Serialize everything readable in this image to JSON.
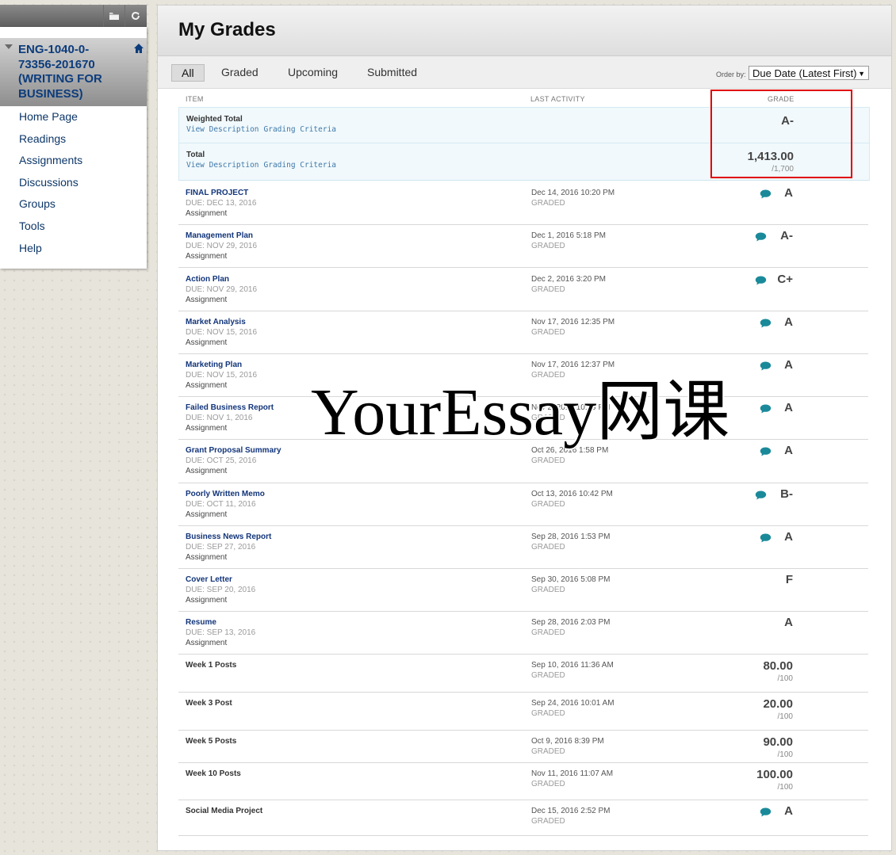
{
  "course_menu": {
    "course_title": "ENG-1040-0-73356-201670 (WRITING FOR BUSINESS)",
    "items": [
      {
        "label": "Home Page"
      },
      {
        "label": "Readings"
      },
      {
        "label": "Assignments"
      },
      {
        "label": "Discussions"
      },
      {
        "label": "Groups"
      },
      {
        "label": "Tools"
      },
      {
        "label": "Help"
      }
    ]
  },
  "page": {
    "title": "My Grades",
    "filters": [
      "All",
      "Graded",
      "Upcoming",
      "Submitted"
    ],
    "active_filter": "All",
    "order_label": "Order by:",
    "order_value": "Due Date (Latest First)"
  },
  "columns": {
    "item": "ITEM",
    "last_activity": "LAST ACTIVITY",
    "grade": "GRADE"
  },
  "summary_rows": [
    {
      "title": "Weighted Total",
      "links": [
        "View Description",
        "Grading Criteria"
      ],
      "grade": "A-",
      "grade_sub": ""
    },
    {
      "title": "Total",
      "links": [
        "View Description",
        "Grading Criteria"
      ],
      "grade": "1,413.00",
      "grade_sub": "/1,700"
    }
  ],
  "rows": [
    {
      "title": "FINAL PROJECT",
      "due": "DUE: DEC 13, 2016",
      "type": "Assignment",
      "date": "Dec 14, 2016 10:20 PM",
      "status": "GRADED",
      "grade": "A",
      "grade_sub": "",
      "feedback": true,
      "link": true
    },
    {
      "title": "Management Plan",
      "due": "DUE: NOV 29, 2016",
      "type": "Assignment",
      "date": "Dec 1, 2016 5:18 PM",
      "status": "GRADED",
      "grade": "A-",
      "grade_sub": "",
      "feedback": true,
      "link": true
    },
    {
      "title": "Action Plan",
      "due": "DUE: NOV 29, 2016",
      "type": "Assignment",
      "date": "Dec 2, 2016 3:20 PM",
      "status": "GRADED",
      "grade": "C+",
      "grade_sub": "",
      "feedback": true,
      "link": true
    },
    {
      "title": "Market Analysis",
      "due": "DUE: NOV 15, 2016",
      "type": "Assignment",
      "date": "Nov 17, 2016 12:35 PM",
      "status": "GRADED",
      "grade": "A",
      "grade_sub": "",
      "feedback": true,
      "link": true
    },
    {
      "title": "Marketing Plan",
      "due": "DUE: NOV 15, 2016",
      "type": "Assignment",
      "date": "Nov 17, 2016 12:37 PM",
      "status": "GRADED",
      "grade": "A",
      "grade_sub": "",
      "feedback": true,
      "link": true
    },
    {
      "title": "Failed Business Report",
      "due": "DUE: NOV 1, 2016",
      "type": "Assignment",
      "date": "Nov 2, 2016 10:59 PM",
      "status": "GRADED",
      "grade": "A",
      "grade_sub": "",
      "feedback": true,
      "link": true
    },
    {
      "title": "Grant Proposal Summary",
      "due": "DUE: OCT 25, 2016",
      "type": "Assignment",
      "date": "Oct 26, 2016 1:58 PM",
      "status": "GRADED",
      "grade": "A",
      "grade_sub": "",
      "feedback": true,
      "link": true
    },
    {
      "title": "Poorly Written Memo",
      "due": "DUE: OCT 11, 2016",
      "type": "Assignment",
      "date": "Oct 13, 2016 10:42 PM",
      "status": "GRADED",
      "grade": "B-",
      "grade_sub": "",
      "feedback": true,
      "link": true
    },
    {
      "title": "Business News Report",
      "due": "DUE: SEP 27, 2016",
      "type": "Assignment",
      "date": "Sep 28, 2016 1:53 PM",
      "status": "GRADED",
      "grade": "A",
      "grade_sub": "",
      "feedback": true,
      "link": true
    },
    {
      "title": "Cover Letter",
      "due": "DUE: SEP 20, 2016",
      "type": "Assignment",
      "date": "Sep 30, 2016 5:08 PM",
      "status": "GRADED",
      "grade": "F",
      "grade_sub": "",
      "feedback": false,
      "link": true
    },
    {
      "title": "Resume",
      "due": "DUE: SEP 13, 2016",
      "type": "Assignment",
      "date": "Sep 28, 2016 2:03 PM",
      "status": "GRADED",
      "grade": "A",
      "grade_sub": "",
      "feedback": false,
      "link": true
    },
    {
      "title": "Week 1 Posts",
      "due": "",
      "type": "",
      "date": "Sep 10, 2016 11:36 AM",
      "status": "GRADED",
      "grade": "80.00",
      "grade_sub": "/100",
      "feedback": false,
      "link": false
    },
    {
      "title": "Week 3 Post",
      "due": "",
      "type": "",
      "date": "Sep 24, 2016 10:01 AM",
      "status": "GRADED",
      "grade": "20.00",
      "grade_sub": "/100",
      "feedback": false,
      "link": false
    },
    {
      "title": "Week 5 Posts",
      "due": "",
      "type": "",
      "date": "Oct 9, 2016 8:39 PM",
      "status": "GRADED",
      "grade": "90.00",
      "grade_sub": "/100",
      "feedback": false,
      "link": false
    },
    {
      "title": "Week 10 Posts",
      "due": "",
      "type": "",
      "date": "Nov 11, 2016 11:07 AM",
      "status": "GRADED",
      "grade": "100.00",
      "grade_sub": "/100",
      "feedback": false,
      "link": false
    },
    {
      "title": "Social Media Project",
      "due": "",
      "type": "",
      "date": "Dec 15, 2016 2:52 PM",
      "status": "GRADED",
      "grade": "A",
      "grade_sub": "",
      "feedback": true,
      "link": false
    }
  ],
  "watermark": "YourEssay网课",
  "icons": {
    "folder": "folder-icon",
    "refresh": "refresh-icon",
    "home": "home-icon",
    "feedback": "speech-bubble-icon"
  },
  "colors": {
    "link": "#12357a",
    "feedback_icon": "#1a8a9a",
    "highlight": "#e00000"
  }
}
